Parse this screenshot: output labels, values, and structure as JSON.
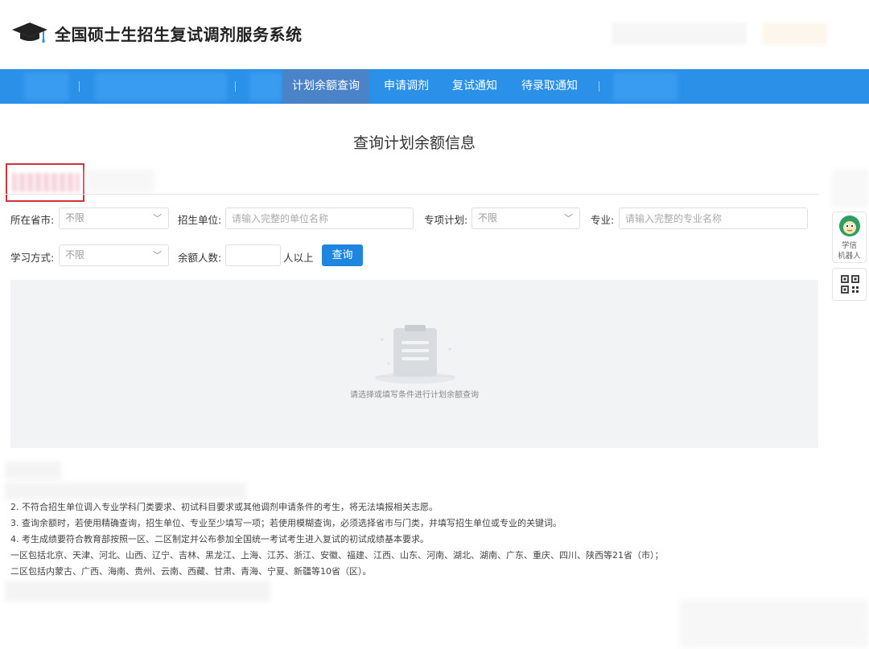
{
  "header": {
    "title": "全国硕士生招生复试调剂服务系统",
    "logo_icon": "graduation-cap-icon"
  },
  "nav": {
    "items": [
      {
        "label": "计划余额查询",
        "active": true
      },
      {
        "label": "申请调剂",
        "active": false
      },
      {
        "label": "复试通知",
        "active": false
      },
      {
        "label": "待录取通知",
        "active": false
      }
    ]
  },
  "page": {
    "heading": "查询计划余额信息"
  },
  "filters": {
    "province_label": "所在省市:",
    "province_value": "不限",
    "unit_label": "招生单位:",
    "unit_placeholder": "请输入完整的单位名称",
    "special_label": "专项计划:",
    "special_value": "不限",
    "major_label": "专业:",
    "major_placeholder": "请输入完整的专业名称",
    "study_mode_label": "学习方式:",
    "study_mode_value": "不限",
    "quota_label": "余额人数:",
    "quota_suffix": "人以上",
    "search_button": "查询"
  },
  "empty_state": {
    "text": "请选择或填写条件进行计划余额查询",
    "icon": "clipboard-icon"
  },
  "notes": [
    "2. 不符合招生单位调入专业学科门类要求、初试科目要求或其他调剂申请条件的考生，将无法填报相关志愿。",
    "3. 查询余额时，若使用精确查询，招生单位、专业至少填写一项；若使用模糊查询，必须选择省市与门类，并填写招生单位或专业的关键词。",
    "4. 考生成绩要符合教育部按照一区、二区制定并公布参加全国统一考试考生进入复试的初试成绩基本要求。",
    "一区包括北京、天津、河北、山西、辽宁、吉林、黑龙江、上海、江苏、浙江、安徽、福建、江西、山东、河南、湖北、湖南、广东、重庆、四川、陕西等21省（市）；",
    "二区包括内蒙古、广西、海南、贵州、云南、西藏、甘肃、青海、宁夏、新疆等10省（区）。"
  ],
  "side": {
    "robot_label_line1": "学信",
    "robot_label_line2": "机器人",
    "robot_icon": "robot-avatar-icon",
    "qr_icon": "qr-code-icon"
  },
  "colors": {
    "nav_bg": "#2a90e8",
    "nav_active": "#4b83c9",
    "button": "#1f86e0",
    "highlight_box": "#d0343a"
  }
}
